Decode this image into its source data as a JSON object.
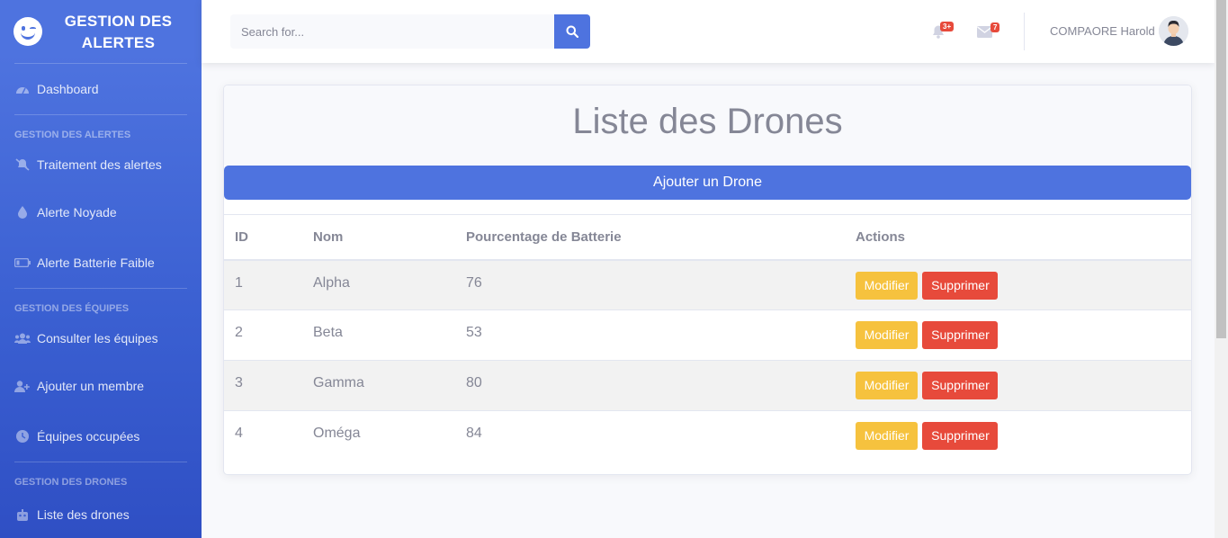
{
  "sidebar": {
    "brand": "GESTION DES ALERTES",
    "items": [
      {
        "label": "Dashboard",
        "icon": "tachometer-icon"
      },
      {
        "label": "Traitement des alertes",
        "icon": "bell-slash-icon"
      },
      {
        "label": "Alerte Noyade",
        "icon": "droplet-icon"
      },
      {
        "label": "Alerte Batterie Faible",
        "icon": "battery-low-icon"
      },
      {
        "label": "Consulter les équipes",
        "icon": "users-icon"
      },
      {
        "label": "Ajouter un membre",
        "icon": "user-plus-icon"
      },
      {
        "label": "Équipes occupées",
        "icon": "clock-icon"
      },
      {
        "label": "Liste des drones",
        "icon": "robot-icon"
      }
    ],
    "headings": [
      "GESTION DES ALERTES",
      "GESTION DES ÉQUIPES",
      "GESTION DES DRONES"
    ]
  },
  "topbar": {
    "search_placeholder": "Search for...",
    "alerts_badge": "3+",
    "messages_badge": "7",
    "user_name": "COMPAORE Harold"
  },
  "main": {
    "title": "Liste des Drones",
    "add_button": "Ajouter un Drone",
    "columns": [
      "ID",
      "Nom",
      "Pourcentage de Batterie",
      "Actions"
    ],
    "rows": [
      {
        "id": "1",
        "name": "Alpha",
        "battery": "76"
      },
      {
        "id": "2",
        "name": "Beta",
        "battery": "53"
      },
      {
        "id": "3",
        "name": "Gamma",
        "battery": "80"
      },
      {
        "id": "4",
        "name": "Oméga",
        "battery": "84"
      }
    ],
    "edit_label": "Modifier",
    "delete_label": "Supprimer"
  },
  "colors": {
    "primary": "#4e73df",
    "warning": "#f6c23e",
    "danger": "#e74a3b"
  }
}
